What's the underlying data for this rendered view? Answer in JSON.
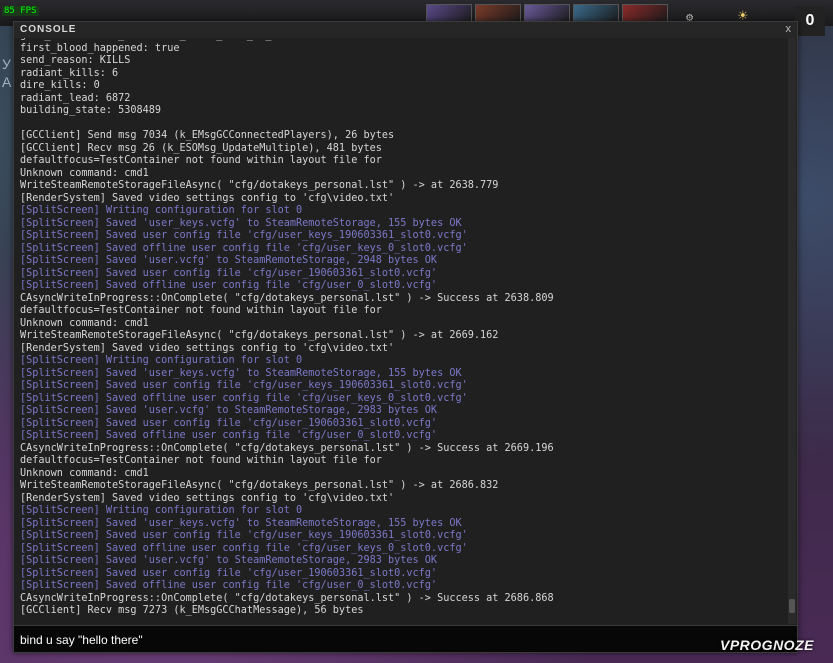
{
  "hud": {
    "fps_text": "85 FPS",
    "score": "0",
    "side_letters": [
      "У",
      "А"
    ]
  },
  "console": {
    "title": "CONSOLE",
    "close_label": "x",
    "input_value": "bind u say \"hello there\"",
    "scroll_position": 0.98
  },
  "log": [
    {
      "text": "game_state: DOTA_GAMERULES_STATE_GAME_IN_PROGRESS",
      "kind": "normal"
    },
    {
      "text": "first_blood_happened: true",
      "kind": "normal"
    },
    {
      "text": "send_reason: KILLS",
      "kind": "normal"
    },
    {
      "text": "radiant_kills: 6",
      "kind": "normal"
    },
    {
      "text": "dire_kills: 0",
      "kind": "normal"
    },
    {
      "text": "radiant_lead: 6872",
      "kind": "normal"
    },
    {
      "text": "building_state: 5308489",
      "kind": "normal"
    },
    {
      "text": "",
      "kind": "blank"
    },
    {
      "text": "[GCClient] Send msg 7034 (k_EMsgGCConnectedPlayers), 26 bytes",
      "kind": "normal"
    },
    {
      "text": "[GCClient] Recv msg 26 (k_ESOMsg_UpdateMultiple), 481 bytes",
      "kind": "normal"
    },
    {
      "text": "defaultfocus=TestContainer not found within layout file for",
      "kind": "normal"
    },
    {
      "text": "Unknown command: cmd1",
      "kind": "normal"
    },
    {
      "text": "WriteSteamRemoteStorageFileAsync( \"cfg/dotakeys_personal.lst\" ) -> at 2638.779",
      "kind": "normal"
    },
    {
      "text": "[RenderSystem] Saved video settings config to 'cfg\\video.txt'",
      "kind": "normal"
    },
    {
      "text": "[SplitScreen] Writing configuration for slot 0",
      "kind": "split"
    },
    {
      "text": "[SplitScreen] Saved 'user_keys.vcfg' to SteamRemoteStorage, 155 bytes OK",
      "kind": "split"
    },
    {
      "text": "[SplitScreen] Saved user config file 'cfg/user_keys_190603361_slot0.vcfg'",
      "kind": "split"
    },
    {
      "text": "[SplitScreen] Saved offline user config file 'cfg/user_keys_0_slot0.vcfg'",
      "kind": "split"
    },
    {
      "text": "[SplitScreen] Saved 'user.vcfg' to SteamRemoteStorage, 2948 bytes OK",
      "kind": "split"
    },
    {
      "text": "[SplitScreen] Saved user config file 'cfg/user_190603361_slot0.vcfg'",
      "kind": "split"
    },
    {
      "text": "[SplitScreen] Saved offline user config file 'cfg/user_0_slot0.vcfg'",
      "kind": "split"
    },
    {
      "text": "CAsyncWriteInProgress::OnComplete( \"cfg/dotakeys_personal.lst\" ) -> Success at 2638.809",
      "kind": "normal"
    },
    {
      "text": "defaultfocus=TestContainer not found within layout file for",
      "kind": "normal"
    },
    {
      "text": "Unknown command: cmd1",
      "kind": "normal"
    },
    {
      "text": "WriteSteamRemoteStorageFileAsync( \"cfg/dotakeys_personal.lst\" ) -> at 2669.162",
      "kind": "normal"
    },
    {
      "text": "[RenderSystem] Saved video settings config to 'cfg\\video.txt'",
      "kind": "normal"
    },
    {
      "text": "[SplitScreen] Writing configuration for slot 0",
      "kind": "split"
    },
    {
      "text": "[SplitScreen] Saved 'user_keys.vcfg' to SteamRemoteStorage, 155 bytes OK",
      "kind": "split"
    },
    {
      "text": "[SplitScreen] Saved user config file 'cfg/user_keys_190603361_slot0.vcfg'",
      "kind": "split"
    },
    {
      "text": "[SplitScreen] Saved offline user config file 'cfg/user_keys_0_slot0.vcfg'",
      "kind": "split"
    },
    {
      "text": "[SplitScreen] Saved 'user.vcfg' to SteamRemoteStorage, 2983 bytes OK",
      "kind": "split"
    },
    {
      "text": "[SplitScreen] Saved user config file 'cfg/user_190603361_slot0.vcfg'",
      "kind": "split"
    },
    {
      "text": "[SplitScreen] Saved offline user config file 'cfg/user_0_slot0.vcfg'",
      "kind": "split"
    },
    {
      "text": "CAsyncWriteInProgress::OnComplete( \"cfg/dotakeys_personal.lst\" ) -> Success at 2669.196",
      "kind": "normal"
    },
    {
      "text": "defaultfocus=TestContainer not found within layout file for",
      "kind": "normal"
    },
    {
      "text": "Unknown command: cmd1",
      "kind": "normal"
    },
    {
      "text": "WriteSteamRemoteStorageFileAsync( \"cfg/dotakeys_personal.lst\" ) -> at 2686.832",
      "kind": "normal"
    },
    {
      "text": "[RenderSystem] Saved video settings config to 'cfg\\video.txt'",
      "kind": "normal"
    },
    {
      "text": "[SplitScreen] Writing configuration for slot 0",
      "kind": "split"
    },
    {
      "text": "[SplitScreen] Saved 'user_keys.vcfg' to SteamRemoteStorage, 155 bytes OK",
      "kind": "split"
    },
    {
      "text": "[SplitScreen] Saved user config file 'cfg/user_keys_190603361_slot0.vcfg'",
      "kind": "split"
    },
    {
      "text": "[SplitScreen] Saved offline user config file 'cfg/user_keys_0_slot0.vcfg'",
      "kind": "split"
    },
    {
      "text": "[SplitScreen] Saved 'user.vcfg' to SteamRemoteStorage, 2983 bytes OK",
      "kind": "split"
    },
    {
      "text": "[SplitScreen] Saved user config file 'cfg/user_190603361_slot0.vcfg'",
      "kind": "split"
    },
    {
      "text": "[SplitScreen] Saved offline user config file 'cfg/user_0_slot0.vcfg'",
      "kind": "split"
    },
    {
      "text": "CAsyncWriteInProgress::OnComplete( \"cfg/dotakeys_personal.lst\" ) -> Success at 2686.868",
      "kind": "normal"
    },
    {
      "text": "[GCClient] Recv msg 7273 (k_EMsgGCChatMessage), 56 bytes",
      "kind": "normal"
    }
  ],
  "hero_colors": [
    "#5b4a8a",
    "#7a3a2a",
    "#6a5a9a",
    "#3a6a8a",
    "#8a2a2a"
  ],
  "watermark_text": "VPROGNOZE",
  "colors": {
    "console_bg": "#202020",
    "log_text": "#d6d6d6",
    "splitscreen_text": "#7b78c8",
    "input_bg": "#070707"
  }
}
